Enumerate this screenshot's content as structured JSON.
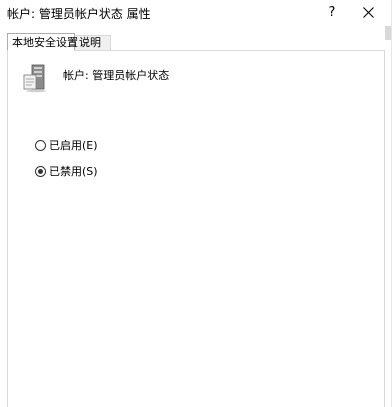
{
  "window": {
    "title": "帐户: 管理员帐户状态 属性",
    "help_glyph": "?",
    "close_icon": "close-icon"
  },
  "tabs": [
    {
      "label": "本地安全设置",
      "active": true
    },
    {
      "label": "说明",
      "active": false
    }
  ],
  "policy": {
    "icon": "server-icon",
    "name": "帐户: 管理员帐户状态"
  },
  "options": [
    {
      "label": "已启用(E)",
      "checked": false
    },
    {
      "label": "已禁用(S)",
      "checked": true
    }
  ]
}
